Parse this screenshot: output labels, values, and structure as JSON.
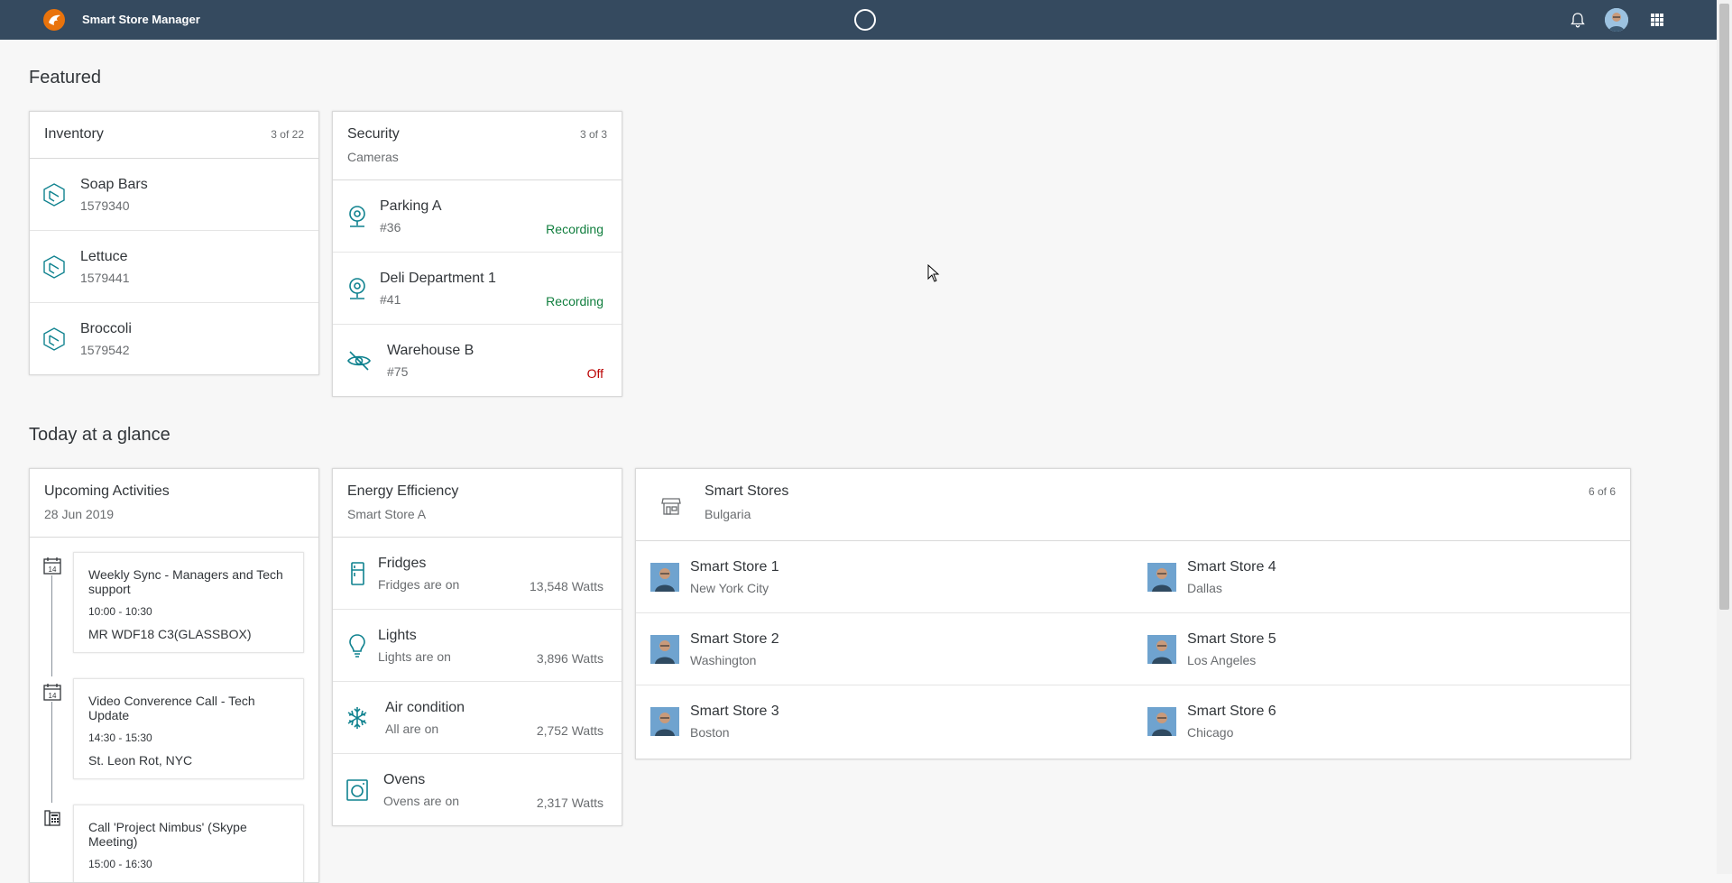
{
  "shell": {
    "title": "Smart Store Manager"
  },
  "sections": {
    "featured": "Featured",
    "today": "Today at a glance"
  },
  "inventory": {
    "title": "Inventory",
    "count": "3 of 22",
    "items": [
      {
        "name": "Soap Bars",
        "id": "1579340"
      },
      {
        "name": "Lettuce",
        "id": "1579441"
      },
      {
        "name": "Broccoli",
        "id": "1579542"
      }
    ]
  },
  "security": {
    "title": "Security",
    "subtitle": "Cameras",
    "count": "3 of 3",
    "items": [
      {
        "name": "Parking A",
        "id": "#36",
        "status": "Recording",
        "status_color": "#107e3e"
      },
      {
        "name": "Deli Department 1",
        "id": "#41",
        "status": "Recording",
        "status_color": "#107e3e"
      },
      {
        "name": "Warehouse B",
        "id": "#75",
        "status": "Off",
        "status_color": "#bb0000"
      }
    ]
  },
  "activities": {
    "title": "Upcoming Activities",
    "subtitle": "28 Jun 2019",
    "calendar_day": "14",
    "items": [
      {
        "title": "Weekly Sync - Managers and Tech support",
        "time": "10:00 - 10:30",
        "location": "MR WDF18 C3(GLASSBOX)"
      },
      {
        "title": "Video Converence Call - Tech Update",
        "time": "14:30 - 15:30",
        "location": "St. Leon Rot, NYC"
      },
      {
        "title": "Call 'Project Nimbus' (Skype Meeting)",
        "time": "15:00 - 16:30",
        "location": ""
      }
    ]
  },
  "energy": {
    "title": "Energy Efficiency",
    "subtitle": "Smart Store A",
    "items": [
      {
        "name": "Fridges",
        "desc": "Fridges are on",
        "value": "13,548 Watts"
      },
      {
        "name": "Lights",
        "desc": "Lights are on",
        "value": "3,896 Watts"
      },
      {
        "name": "Air condition",
        "desc": "All are on",
        "value": "2,752 Watts"
      },
      {
        "name": "Ovens",
        "desc": "Ovens are on",
        "value": "2,317 Watts"
      }
    ]
  },
  "stores": {
    "title": "Smart Stores",
    "subtitle": "Bulgaria",
    "count": "6 of 6",
    "items": [
      {
        "name": "Smart Store 1",
        "city": "New York City"
      },
      {
        "name": "Smart Store 4",
        "city": "Dallas"
      },
      {
        "name": "Smart Store 2",
        "city": "Washington"
      },
      {
        "name": "Smart Store 5",
        "city": "Los Angeles"
      },
      {
        "name": "Smart Store 3",
        "city": "Boston"
      },
      {
        "name": "Smart Store 6",
        "city": "Chicago"
      }
    ]
  },
  "colors": {
    "shell": "#354a5f",
    "accent": "#0a6ed1",
    "icon_teal": "#0f828f",
    "positive": "#107e3e",
    "negative": "#bb0000"
  }
}
